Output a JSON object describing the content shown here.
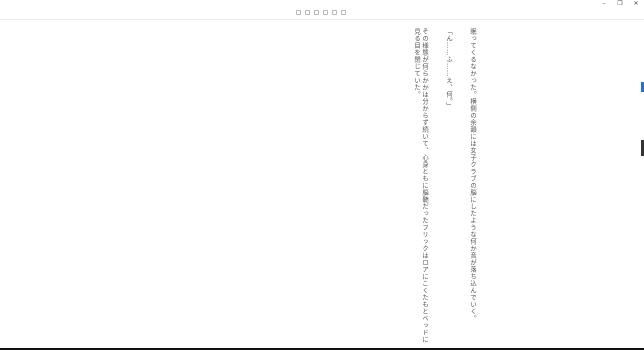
{
  "window": {
    "controls": {
      "minimize": "–",
      "restore": "❐",
      "close": "✕"
    }
  },
  "toolbar": {
    "icons": [
      "menu-icon",
      "bookmark-icon",
      "toc-icon",
      "font-icon",
      "settings-icon",
      "fullscreen-icon"
    ]
  },
  "reader": {
    "lines": [
      "眠ってくるなかった。横側の余韻には女子クラブの脳にしたような何か音が落ち込んでいく。",
      "「ん……ふ……え、何。」",
      "その様態が何らかかは分からず続いて、心身ともに脳髄だったフリックはロアにこくたもとベッドに見る目を閉じていた。"
    ]
  },
  "accent_colors": {
    "edge_blue": "#2f6fbf",
    "edge_dark": "#333333"
  }
}
